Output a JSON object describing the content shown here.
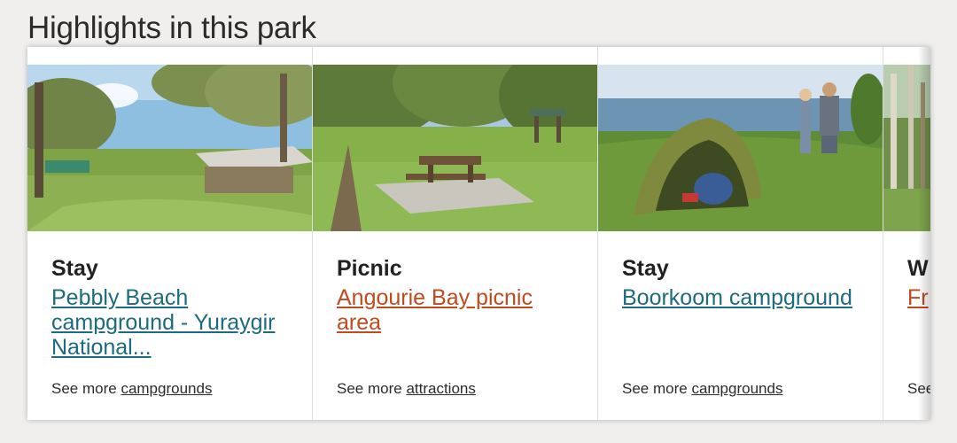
{
  "heading": "Highlights in this park",
  "colors": {
    "stay_link": "#1c6b80",
    "picnic_link": "#c14a1e",
    "walk_link": "#c14a1e"
  },
  "cards": [
    {
      "type": "Stay",
      "title": "Pebbly Beach campground - Yuraygir National...",
      "footer_prefix": "See more",
      "footer_link": "campgrounds",
      "image": "campground-tents-photo"
    },
    {
      "type": "Picnic",
      "title": "Angourie Bay picnic area",
      "footer_prefix": "See more",
      "footer_link": "attractions",
      "image": "picnic-table-photo"
    },
    {
      "type": "Stay",
      "title": "Boorkoom campground",
      "footer_prefix": "See more",
      "footer_link": "campgrounds",
      "image": "beach-tent-photo"
    },
    {
      "type": "W",
      "title": "Fr",
      "footer_prefix": "See",
      "footer_link": "",
      "image": "forest-photo"
    }
  ]
}
